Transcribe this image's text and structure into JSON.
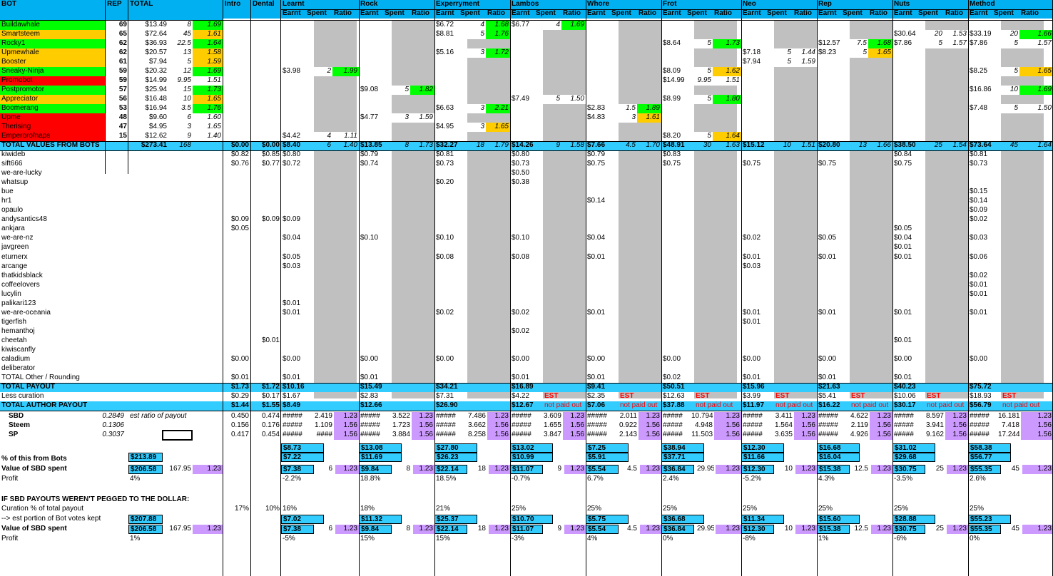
{
  "headers": {
    "top": [
      "BOT",
      "REP",
      "TOTAL",
      "Intro",
      "Dental",
      "Learnt",
      "Rock",
      "Experryment",
      "Lambos",
      "Whore",
      "Frot",
      "Neo",
      "Rep",
      "Nuts",
      "Method"
    ],
    "sub": [
      "Earnt",
      "Spent",
      "Ratio"
    ]
  },
  "bots": [
    {
      "name": "Buildawhale",
      "rep": "69",
      "total": "$13.49",
      "spent": "8",
      "ratio": "1.69",
      "color": "#00ff00",
      "cells": {
        "4": [
          "$6.72",
          "4",
          "1.68"
        ],
        "5": [
          "$6.77",
          "4",
          "1.69"
        ]
      }
    },
    {
      "name": "Smartsteem",
      "rep": "65",
      "total": "$72.64",
      "spent": "45",
      "ratio": "1.61",
      "color": "#ffcc00",
      "cells": {
        "4": [
          "$8.81",
          "5",
          "1.76"
        ],
        "10": [
          "$30.64",
          "20",
          "1.53"
        ],
        "11": [
          "$33.19",
          "20",
          "1.66"
        ]
      }
    },
    {
      "name": "Rocky1",
      "rep": "62",
      "total": "$36.93",
      "spent": "22.5",
      "ratio": "1.64",
      "color": "#00ff00",
      "cells": {
        "7": [
          "$8.64",
          "5",
          "1.73"
        ],
        "9": [
          "$12.57",
          "7.5",
          "1.68"
        ],
        "10": [
          "$7.86",
          "5",
          "1.57"
        ],
        "11": [
          "$7.86",
          "5",
          "1.57"
        ]
      }
    },
    {
      "name": "Upmewhale",
      "rep": "62",
      "total": "$20.57",
      "spent": "13",
      "ratio": "1.58",
      "color": "#ffcc00",
      "cells": {
        "4": [
          "$5.16",
          "3",
          "1.72"
        ],
        "8": [
          "$7.18",
          "5",
          "1.44"
        ],
        "9": [
          "$8.23",
          "5",
          "1.65"
        ]
      }
    },
    {
      "name": "Booster",
      "rep": "61",
      "total": "$7.94",
      "spent": "5",
      "ratio": "1.59",
      "color": "#ffcc00",
      "cells": {
        "8": [
          "$7.94",
          "5",
          "1.59"
        ]
      }
    },
    {
      "name": "Sneaky-Ninja",
      "rep": "59",
      "total": "$20.32",
      "spent": "12",
      "ratio": "1.69",
      "color": "#00ff00",
      "cells": {
        "2": [
          "$3.98",
          "2",
          "1.99"
        ],
        "7": [
          "$8.09",
          "5",
          "1.62"
        ],
        "11": [
          "$8.25",
          "5",
          "1.65"
        ]
      }
    },
    {
      "name": "Promobot",
      "rep": "59",
      "total": "$14.99",
      "spent": "9.95",
      "ratio": "1.51",
      "color": "#ff0000",
      "cells": {
        "7": [
          "$14.99",
          "9.95",
          "1.51"
        ]
      }
    },
    {
      "name": "Postpromotor",
      "rep": "57",
      "total": "$25.94",
      "spent": "15",
      "ratio": "1.73",
      "color": "#00ff00",
      "cells": {
        "3": [
          "$9.08",
          "5",
          "1.82"
        ],
        "11": [
          "$16.86",
          "10",
          "1.69"
        ]
      }
    },
    {
      "name": "Appreciator",
      "rep": "56",
      "total": "$16.48",
      "spent": "10",
      "ratio": "1.65",
      "color": "#ffcc00",
      "cells": {
        "5": [
          "$7.49",
          "5",
          "1.50"
        ],
        "7": [
          "$8.99",
          "5",
          "1.80"
        ]
      }
    },
    {
      "name": "Boomerang",
      "rep": "53",
      "total": "$16.94",
      "spent": "3.5",
      "ratio": "1.76",
      "color": "#00ff00",
      "cells": {
        "4": [
          "$6.63",
          "3",
          "2.21"
        ],
        "6": [
          "$2.83",
          "1.5",
          "1.89"
        ],
        "11": [
          "$7.48",
          "5",
          "1.50"
        ]
      }
    },
    {
      "name": "Upme",
      "rep": "48",
      "total": "$9.60",
      "spent": "6",
      "ratio": "1.60",
      "color": "#ff0000",
      "cells": {
        "3": [
          "$4.77",
          "3",
          "1.59"
        ],
        "6": [
          "$4.83",
          "3",
          "1.61"
        ]
      }
    },
    {
      "name": "Therising",
      "rep": "47",
      "total": "$4.95",
      "spent": "3",
      "ratio": "1.65",
      "color": "#ff0000",
      "cells": {
        "4": [
          "$4.95",
          "3",
          "1.65"
        ]
      }
    },
    {
      "name": "Emperorofnaps",
      "rep": "15",
      "total": "$12.62",
      "spent": "9",
      "ratio": "1.40",
      "color": "#ff0000",
      "cells": {
        "2": [
          "$4.42",
          "4",
          "1.11"
        ],
        "7": [
          "$8.20",
          "5",
          "1.64"
        ]
      }
    }
  ],
  "bot_totals": {
    "label": "TOTAL VALUES FROM BOTS",
    "total": "$273.41",
    "spent": "168",
    "intro": "$0.00",
    "dental": "$0.00",
    "cols": [
      [
        "$8.40",
        "6",
        "1.40"
      ],
      [
        "$13.85",
        "8",
        "1.73"
      ],
      [
        "$32.27",
        "18",
        "1.79"
      ],
      [
        "$14.26",
        "9",
        "1.58"
      ],
      [
        "$7.66",
        "4.5",
        "1.70"
      ],
      [
        "$48.91",
        "30",
        "1.63"
      ],
      [
        "$15.12",
        "10",
        "1.51"
      ],
      [
        "$20.80",
        "13",
        "1.66"
      ],
      [
        "$38.50",
        "25",
        "1.54"
      ],
      [
        "$73.64",
        "45",
        "1.64"
      ]
    ]
  },
  "authors": [
    {
      "name": "kiwideb",
      "intro": "$0.82",
      "dental": "$0.85",
      "v": {
        "0": "$0.80",
        "1": "$0.79",
        "2": "$0.81",
        "3": "$0.80",
        "4": "$0.79",
        "5": "$0.83",
        "8": "$0.84",
        "9": "$0.81"
      }
    },
    {
      "name": "sift666",
      "intro": "$0.76",
      "dental": "$0.77",
      "v": {
        "0": "$0.72",
        "1": "$0.74",
        "2": "$0.73",
        "3": "$0.73",
        "4": "$0.75",
        "5": "$0.75",
        "6": "$0.75",
        "7": "$0.75",
        "8": "$0.75",
        "9": "$0.73"
      }
    },
    {
      "name": "we-are-lucky",
      "v": {
        "3": "$0.50"
      }
    },
    {
      "name": "whatsup",
      "v": {
        "2": "$0.20",
        "3": "$0.38"
      }
    },
    {
      "name": "bue",
      "v": {
        "9": "$0.15"
      }
    },
    {
      "name": "hr1",
      "v": {
        "4": "$0.14",
        "9": "$0.14"
      }
    },
    {
      "name": "opaulo",
      "v": {
        "9": "$0.09"
      }
    },
    {
      "name": "andysantics48",
      "intro": "$0.09",
      "dental": "$0.09",
      "v": {
        "0": "$0.09",
        "9": "$0.02"
      }
    },
    {
      "name": "ankjara",
      "intro": "$0.05",
      "v": {
        "8": "$0.05"
      }
    },
    {
      "name": "we-are-nz",
      "v": {
        "0": "$0.04",
        "1": "$0.10",
        "2": "$0.10",
        "3": "$0.10",
        "4": "$0.04",
        "6": "$0.02",
        "7": "$0.05",
        "8": "$0.04",
        "9": "$0.03"
      }
    },
    {
      "name": "javgreen",
      "v": {
        "8": "$0.01"
      }
    },
    {
      "name": "eturnerx",
      "v": {
        "0": "$0.05",
        "2": "$0.08",
        "3": "$0.08",
        "4": "$0.01",
        "6": "$0.01",
        "7": "$0.01",
        "8": "$0.01",
        "9": "$0.06"
      }
    },
    {
      "name": "arcange",
      "v": {
        "0": "$0.03",
        "6": "$0.03"
      }
    },
    {
      "name": "thatkidsblack",
      "v": {
        "9": "$0.02"
      }
    },
    {
      "name": "coffeelovers",
      "v": {
        "9": "$0.01"
      }
    },
    {
      "name": "lucylin",
      "v": {
        "9": "$0.01"
      }
    },
    {
      "name": "palikari123",
      "v": {
        "0": "$0.01"
      }
    },
    {
      "name": "we-are-oceania",
      "v": {
        "0": "$0.01",
        "2": "$0.02",
        "3": "$0.02",
        "4": "$0.01",
        "6": "$0.01",
        "7": "$0.01",
        "8": "$0.01",
        "9": "$0.01"
      }
    },
    {
      "name": "tigerfish",
      "v": {
        "6": "$0.01"
      }
    },
    {
      "name": "hemanthoj",
      "v": {
        "3": "$0.02"
      }
    },
    {
      "name": "cheetah",
      "dental": "$0.01",
      "v": {
        "8": "$0.01"
      }
    },
    {
      "name": "kiwiscanfly",
      "v": {}
    },
    {
      "name": "caladium",
      "intro": "$0.00",
      "v": {
        "0": "$0.00",
        "1": "$0.00",
        "2": "$0.00",
        "3": "$0.00",
        "4": "$0.00",
        "5": "$0.00",
        "6": "$0.00",
        "7": "$0.00",
        "8": "$0.00",
        "9": "$0.00"
      }
    },
    {
      "name": "deliberator",
      "v": {}
    },
    {
      "name": "TOTAL Other / Rounding",
      "intro": "$0.01",
      "v": {
        "0": "$0.01",
        "1": "$0.01",
        "3": "$0.01",
        "4": "$0.01",
        "5": "$0.02",
        "6": "$0.01",
        "7": "$0.01",
        "8": "$0.01"
      }
    }
  ],
  "total_payout": {
    "label": "TOTAL PAYOUT",
    "intro": "$1.73",
    "dental": "$1.72",
    "v": [
      "$10.16",
      "$15.49",
      "$34.21",
      "$16.89",
      "$9.41",
      "$50.51",
      "$15.96",
      "$21.63",
      "$40.23",
      "$75.72"
    ]
  },
  "less_curation": {
    "label": "Less curation",
    "intro": "$0.29",
    "dental": "$0.17",
    "v": [
      "$1.67",
      "$2.83",
      "$7.31",
      "$4.22",
      "$2.35",
      "$12.63",
      "$3.99",
      "$5.41",
      "$10.06",
      "$18.93"
    ],
    "est": "EST"
  },
  "author_payout": {
    "label": "TOTAL AUTHOR PAYOUT",
    "intro": "$1.44",
    "dental": "$1.55",
    "v": [
      "$8.49",
      "$12.66",
      "$26.90",
      "$12.67",
      "$7.06",
      "$37.88",
      "$11.97",
      "$16.22",
      "$30.17",
      "$56.79"
    ],
    "not_paid": "not paid out"
  },
  "split_rows": [
    {
      "label": "SBD",
      "ratio": "0.2849",
      "note": "est ratio of payout",
      "intro": "0.450",
      "dental": "0.474",
      "hash": "#####",
      "v": [
        [
          "2.419",
          "1.23"
        ],
        [
          "3.522",
          "1.23"
        ],
        [
          "7.486",
          "1.23"
        ],
        [
          "3.609",
          "1.23"
        ],
        [
          "2.011",
          "1.23"
        ],
        [
          "10.794",
          "1.23"
        ],
        [
          "3.411",
          "1.23"
        ],
        [
          "4.622",
          "1.23"
        ],
        [
          "8.597",
          "1.23"
        ],
        [
          "16.181",
          "1.23"
        ]
      ]
    },
    {
      "label": "Steem",
      "ratio": "0.1306",
      "intro": "0.156",
      "dental": "0.176",
      "hash": "#####",
      "v": [
        [
          "1.109",
          "1.56"
        ],
        [
          "1.723",
          "1.56"
        ],
        [
          "3.662",
          "1.56"
        ],
        [
          "1.655",
          "1.56"
        ],
        [
          "0.922",
          "1.56"
        ],
        [
          "4.948",
          "1.56"
        ],
        [
          "1.564",
          "1.56"
        ],
        [
          "2.119",
          "1.56"
        ],
        [
          "3.941",
          "1.56"
        ],
        [
          "7.418",
          "1.56"
        ]
      ]
    },
    {
      "label": "SP",
      "ratio": "0.3037",
      "intro": "0.417",
      "dental": "0.454",
      "hash": "#####",
      "v": [
        [
          "####",
          "1.56"
        ],
        [
          "3.884",
          "1.56"
        ],
        [
          "8.258",
          "1.56"
        ],
        [
          "3.847",
          "1.56"
        ],
        [
          "2.143",
          "1.56"
        ],
        [
          "11.503",
          "1.56"
        ],
        [
          "3.635",
          "1.56"
        ],
        [
          "4.926",
          "1.56"
        ],
        [
          "9.162",
          "1.56"
        ],
        [
          "17.244",
          "1.56"
        ]
      ]
    }
  ],
  "sum_rows": {
    "row1": [
      "$8.73",
      "$13.08",
      "$27.80",
      "$13.02",
      "$7.25",
      "$38.94",
      "$12.30",
      "$16.68",
      "$31.02",
      "$58.38"
    ],
    "pct_label": "% of this from Bots",
    "pct_total": "$213.89",
    "pct_v": [
      "$7.22",
      "$11.69",
      "$26.23",
      "$10.99",
      "$5.91",
      "$37.71",
      "$11.66",
      "$16.04",
      "$29.68",
      "$56.77"
    ]
  },
  "value_spent": {
    "label": "Value of SBD spent",
    "total": "$206.58",
    "spent": "167.95",
    "ratio": "1.23",
    "v": [
      [
        "$7.38",
        "6",
        "1.23"
      ],
      [
        "$9.84",
        "8",
        "1.23"
      ],
      [
        "$22.14",
        "18",
        "1.23"
      ],
      [
        "$11.07",
        "9",
        "1.23"
      ],
      [
        "$5.54",
        "4.5",
        "1.23"
      ],
      [
        "$36.84",
        "29.95",
        "1.23"
      ],
      [
        "$12.30",
        "10",
        "1.23"
      ],
      [
        "$15.38",
        "12.5",
        "1.23"
      ],
      [
        "$30.75",
        "25",
        "1.23"
      ],
      [
        "$55.35",
        "45",
        "1.23"
      ]
    ]
  },
  "profit1": {
    "label": "Profit",
    "total": "4%",
    "v": [
      "-2.2%",
      "18.8%",
      "18.5%",
      "-0.7%",
      "6.7%",
      "2.4%",
      "-5.2%",
      "4.3%",
      "-3.5%",
      "2.6%"
    ]
  },
  "pegged_title": "IF SBD PAYOUTS WEREN'T PEGGED TO THE DOLLAR:",
  "curation_pct": {
    "label": "Curation % of total payout",
    "intro": "17%",
    "dental": "10%",
    "v": [
      "16%",
      "18%",
      "21%",
      "25%",
      "25%",
      "25%",
      "25%",
      "25%",
      "25%",
      "25%"
    ]
  },
  "kept": {
    "label": "--> est portion of Bot votes kept",
    "total": "$207.88",
    "v": [
      "$7.02",
      "$11.32",
      "$25.37",
      "$10.70",
      "$5.75",
      "$36.68",
      "$11.34",
      "$15.60",
      "$28.88",
      "$55.23"
    ]
  },
  "value_spent2": {
    "label": "Value of SBD spent",
    "total": "$206.58",
    "spent": "167.95",
    "ratio": "1.23",
    "v": [
      [
        "$7.38",
        "6",
        "1.23"
      ],
      [
        "$9.84",
        "8",
        "1.23"
      ],
      [
        "$22.14",
        "18",
        "1.23"
      ],
      [
        "$11.07",
        "9",
        "1.23"
      ],
      [
        "$5.54",
        "4.5",
        "1.23"
      ],
      [
        "$36.84",
        "29.95",
        "1.23"
      ],
      [
        "$12.30",
        "10",
        "1.23"
      ],
      [
        "$15.38",
        "12.5",
        "1.23"
      ],
      [
        "$30.75",
        "25",
        "1.23"
      ],
      [
        "$55.35",
        "45",
        "1.23"
      ]
    ]
  },
  "profit2": {
    "label": "Profit",
    "total": "1%",
    "v": [
      "-5%",
      "15%",
      "15%",
      "-3%",
      "4%",
      "0%",
      "-8%",
      "1%",
      "-6%",
      "0%"
    ]
  },
  "colors": {
    "header_blue": "#00b0f0",
    "cyan": "#33ccff",
    "gray": "#c0c0c0",
    "green": "#00ff00",
    "orange": "#ffcc00",
    "red": "#ff0000",
    "purple": "#cc99ff",
    "est_red": "#ff0000"
  }
}
